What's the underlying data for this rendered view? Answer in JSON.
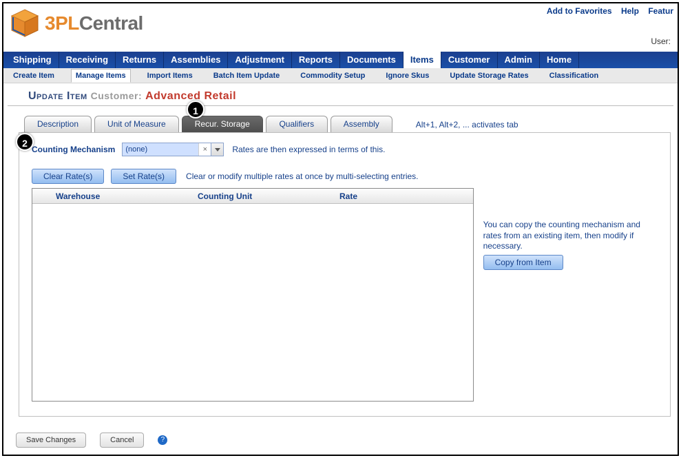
{
  "top_links": {
    "favorites": "Add to Favorites",
    "help": "Help",
    "features": "Featur"
  },
  "user_label": "User:",
  "logo": {
    "part1": "3PL",
    "part2": "Central"
  },
  "menu": [
    "Shipping",
    "Receiving",
    "Returns",
    "Assemblies",
    "Adjustment",
    "Reports",
    "Documents",
    "Items",
    "Customer",
    "Admin",
    "Home"
  ],
  "menu_active_index": 7,
  "submenu": [
    "Create Item",
    "Manage Items",
    "Import Items",
    "Batch Item Update",
    "Commodity Setup",
    "Ignore Skus",
    "Update Storage Rates",
    "Classification"
  ],
  "submenu_active_index": 1,
  "page_title": {
    "main": "Update Item",
    "cust_label": "Customer:",
    "cust_name": "Advanced Retail"
  },
  "tabs": [
    "Description",
    "Unit of Measure",
    "Recur. Storage",
    "Qualifiers",
    "Assembly"
  ],
  "tabs_active_index": 2,
  "tabs_hint": "Alt+1, Alt+2, ... activates tab",
  "counting": {
    "label": "Counting Mechanism",
    "value": "(none)",
    "hint": "Rates are then expressed in terms of this."
  },
  "rate_buttons": {
    "clear": "Clear Rate(s)",
    "set": "Set Rate(s)",
    "hint": "Clear or modify multiple rates at once by multi-selecting entries."
  },
  "table": {
    "headers": {
      "warehouse": "Warehouse",
      "counting_unit": "Counting Unit",
      "rate": "Rate"
    }
  },
  "copy": {
    "text": "You can copy the counting mechanism and rates from an existing item, then modify if necessary.",
    "button": "Copy from Item"
  },
  "footer": {
    "save": "Save Changes",
    "cancel": "Cancel"
  },
  "callouts": {
    "one": "1",
    "two": "2"
  }
}
